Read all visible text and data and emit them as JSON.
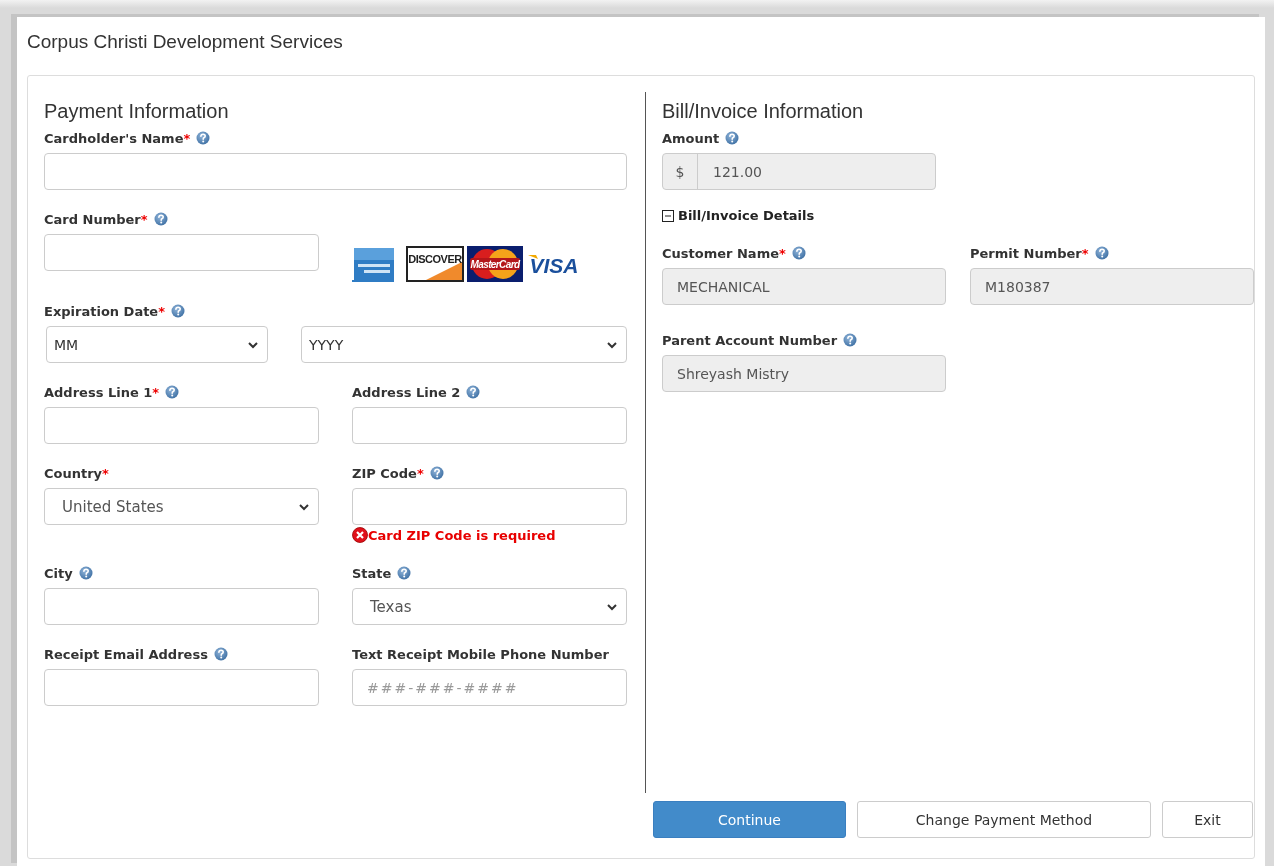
{
  "title": "Corpus Christi Development Services",
  "payment": {
    "heading": "Payment Information",
    "rows": [
      [
        {
          "kind": "input",
          "label": "Cardholder's Name",
          "required_mark": "*",
          "help": true,
          "readonly": false
        }
      ],
      [
        {
          "kind": "input",
          "label": "Card Number",
          "required_mark": "*",
          "help": true,
          "readonly": false
        },
        {
          "kind": "logos",
          "logos": [
            {
              "kind": "amex"
            },
            {
              "kind": "discover",
              "text": "DISCOVER"
            },
            {
              "kind": "mastercard",
              "text": "MasterCard"
            },
            {
              "kind": "visa",
              "text": "VISA"
            }
          ]
        }
      ],
      [
        {
          "kind": "expiry",
          "label": "Expiration Date",
          "required_mark": "*",
          "help": true,
          "selects": [
            "MM",
            "YYYY"
          ]
        }
      ],
      [
        {
          "kind": "input",
          "label": "Address Line 1",
          "required_mark": "*",
          "help": true,
          "readonly": false
        },
        {
          "kind": "input",
          "label": "Address Line 2",
          "help": true,
          "readonly": false
        }
      ],
      [
        {
          "kind": "select",
          "label": "Country",
          "required_mark": "*",
          "help": false,
          "value": "United States"
        },
        {
          "kind": "input",
          "label": "ZIP Code",
          "required_mark": "*",
          "help": true,
          "readonly": false,
          "error": "Card ZIP Code is required"
        }
      ],
      [
        {
          "kind": "input",
          "label": "City",
          "help": true,
          "readonly": false
        },
        {
          "kind": "select",
          "label": "State",
          "help": true,
          "value": "Texas"
        }
      ],
      [
        {
          "kind": "input",
          "label": "Receipt Email Address",
          "help": true,
          "readonly": false
        },
        {
          "kind": "input",
          "label": "Text Receipt Mobile Phone Number",
          "help": false,
          "readonly": false,
          "placeholder": "###-###-####"
        }
      ]
    ]
  },
  "invoice": {
    "heading": "Bill/Invoice Information",
    "amount": {
      "label": "Amount",
      "help": true,
      "prefix": "$",
      "value": "121.00"
    },
    "details": {
      "label": "Bill/Invoice Details",
      "expanded": true,
      "rows": [
        [
          {
            "kind": "input",
            "label": "Customer Name",
            "required_mark": "*",
            "help": true,
            "readonly": true,
            "value": "MECHANICAL"
          },
          {
            "kind": "input",
            "label": "Permit Number",
            "required_mark": "*",
            "help": true,
            "readonly": true,
            "value": "M180387"
          }
        ],
        [
          {
            "kind": "input",
            "label": "Parent Account Number",
            "help": true,
            "readonly": true,
            "value": "Shreyash Mistry"
          }
        ]
      ]
    }
  },
  "buttons": [
    {
      "label": "Continue",
      "kind": "primary"
    },
    {
      "label": "Change Payment Method",
      "kind": "default"
    },
    {
      "label": "Exit",
      "kind": "default"
    }
  ]
}
